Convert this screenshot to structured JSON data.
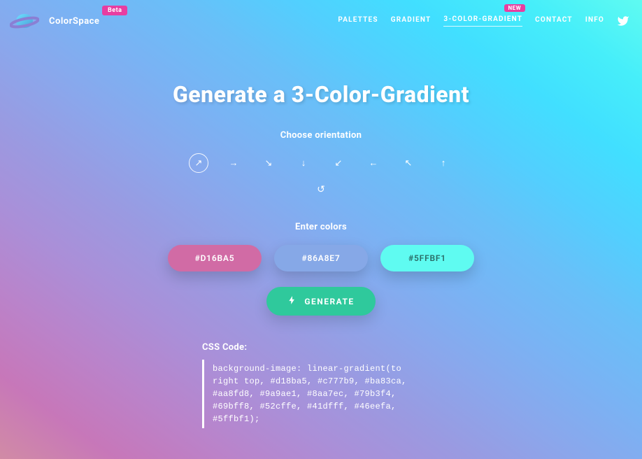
{
  "brand": {
    "name": "ColorSpace",
    "badge": "Beta"
  },
  "nav": {
    "palettes": "PALETTES",
    "gradient": "GRADIENT",
    "three_color": "3-COLOR-GRADIENT",
    "three_color_badge": "NEW",
    "contact": "CONTACT",
    "info": "INFO"
  },
  "main": {
    "title": "Generate a 3-Color-Gradient",
    "orientation_label": "Choose orientation",
    "colors_label": "Enter colors",
    "generate_label": "GENERATE",
    "code_label": "CSS Code:",
    "code_text": "background-image: linear-gradient(to right top, #d18ba5, #c777b9, #ba83ca, #aa8fd8, #9a9ae1, #8aa7ec, #79b3f4, #69bff8, #52cffe, #41dfff, #46eefa, #5ffbf1);"
  },
  "colors": {
    "c1": "#D16BA5",
    "c2": "#86A8E7",
    "c3": "#5FFBF1"
  },
  "orientations": [
    {
      "name": "right-top",
      "arrow": "↗",
      "selected": true
    },
    {
      "name": "right",
      "arrow": "→",
      "selected": false
    },
    {
      "name": "right-bottom",
      "arrow": "↘",
      "selected": false
    },
    {
      "name": "bottom",
      "arrow": "↓",
      "selected": false
    },
    {
      "name": "left-bottom",
      "arrow": "↙",
      "selected": false
    },
    {
      "name": "left",
      "arrow": "←",
      "selected": false
    },
    {
      "name": "left-top",
      "arrow": "↖",
      "selected": false
    },
    {
      "name": "top",
      "arrow": "↑",
      "selected": false
    }
  ]
}
